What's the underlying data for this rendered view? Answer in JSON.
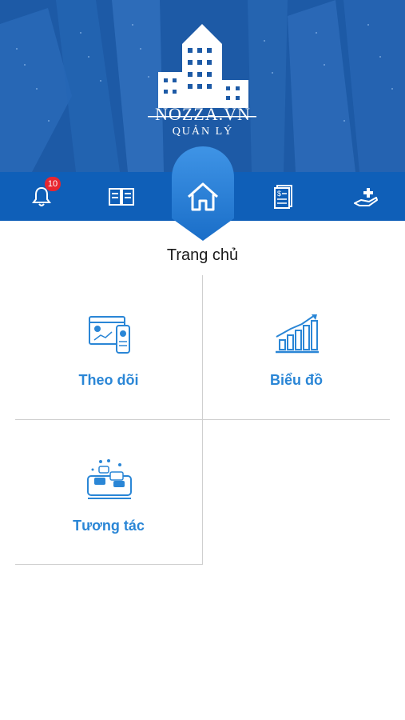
{
  "header": {
    "logo_title": "NOZZA.VN",
    "logo_subtitle": "QUẢN LÝ"
  },
  "nav": {
    "items": [
      {
        "icon": "bell-icon",
        "badge": "10"
      },
      {
        "icon": "book-icon"
      },
      {
        "icon": "home-icon",
        "active": true
      },
      {
        "icon": "document-icon"
      },
      {
        "icon": "hand-plus-icon"
      }
    ]
  },
  "page": {
    "title": "Trang chủ"
  },
  "tiles": [
    {
      "label": "Theo dõi",
      "icon": "monitor-tracking-icon"
    },
    {
      "label": "Biểu đồ",
      "icon": "bar-chart-icon"
    },
    {
      "label": "Tương tác",
      "icon": "chat-interaction-icon"
    }
  ],
  "colors": {
    "nav_bg": "#0f5fb8",
    "accent": "#2a86d6",
    "badge": "#e8262f"
  }
}
